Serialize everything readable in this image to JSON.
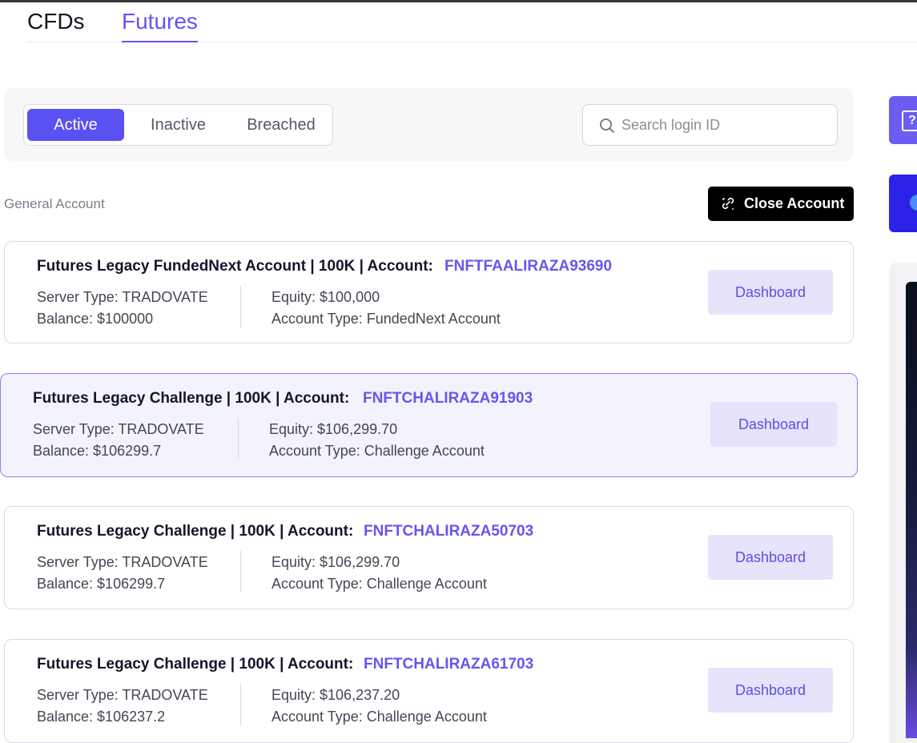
{
  "market_tabs": [
    {
      "label": "CFDs"
    },
    {
      "label": "Futures"
    }
  ],
  "status_filter": {
    "active": "Active",
    "inactive": "Inactive",
    "breached": "Breached"
  },
  "search": {
    "placeholder": "Search login ID"
  },
  "section": {
    "label": "General Account",
    "close_button": "Close Account"
  },
  "accounts": [
    {
      "title": "Futures Legacy FundedNext Account | 100K | Account:",
      "account_id": "FNFTFAALIRAZA93690",
      "server_type": "Server Type: TRADOVATE",
      "balance": "Balance: $100000",
      "equity": "Equity: $100,000",
      "account_type": "Account Type: FundedNext Account",
      "button": "Dashboard"
    },
    {
      "title": "Futures Legacy Challenge | 100K | Account:",
      "account_id": "FNFTCHALIRAZA91903",
      "server_type": "Server Type: TRADOVATE",
      "balance": "Balance: $106299.7",
      "equity": "Equity: $106,299.70",
      "account_type": "Account Type: Challenge Account",
      "button": "Dashboard"
    },
    {
      "title": "Futures Legacy Challenge | 100K | Account:",
      "account_id": "FNFTCHALIRAZA50703",
      "server_type": "Server Type: TRADOVATE",
      "balance": "Balance: $106299.7",
      "equity": "Equity: $106,299.70",
      "account_type": "Account Type: Challenge Account",
      "button": "Dashboard"
    },
    {
      "title": "Futures Legacy Challenge | 100K | Account:",
      "account_id": "FNFTCHALIRAZA61703",
      "server_type": "Server Type: TRADOVATE",
      "balance": "Balance: $106237.2",
      "equity": "Equity: $106,237.20",
      "account_type": "Account Type: Challenge Account",
      "button": "Dashboard"
    }
  ],
  "side": {
    "help_icon": "?"
  },
  "colors": {
    "accent": "#5b50f2",
    "account_id": "#6556f0",
    "dashboard_bg": "#e6e3fb",
    "close_bg": "#000000"
  }
}
